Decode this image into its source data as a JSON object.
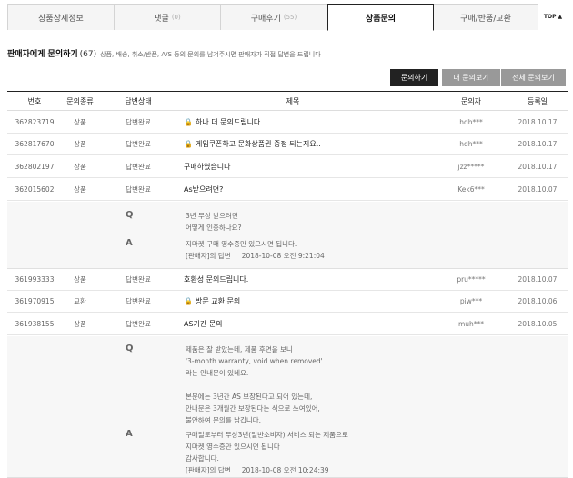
{
  "tabs": [
    {
      "label": "상품상세정보",
      "count": ""
    },
    {
      "label": "댓글",
      "count": "(0)"
    },
    {
      "label": "구매후기",
      "count": "(55)"
    },
    {
      "label": "상품문의",
      "count": ""
    },
    {
      "label": "구매/반품/교환",
      "count": ""
    },
    {
      "label": "TOP",
      "count": ""
    }
  ],
  "heading": {
    "title": "판매자에게 문의하기",
    "count": "(67)",
    "desc": "상품, 배송, 취소/반품, A/S 등의 문의를 남겨주시면 판매자가 직접 답변을 드립니다"
  },
  "buttons": {
    "ask": "문의하기",
    "my": "내 문의보기",
    "all": "전체 문의보기"
  },
  "columns": [
    "번호",
    "문의종류",
    "답변상태",
    "제목",
    "문의자",
    "등록일"
  ],
  "rows": [
    {
      "num": "362823719",
      "type": "상품",
      "status": "답변완료",
      "title": "하나 더 문의드립니다..",
      "locked": "🔒",
      "author": "hdh***",
      "date": "2018.10.17"
    },
    {
      "num": "362817670",
      "type": "상품",
      "status": "답변완료",
      "title": "게임쿠폰하고 문화상품권 증정 되는지요..",
      "locked": "🔒",
      "author": "hdh***",
      "date": "2018.10.17"
    },
    {
      "num": "362802197",
      "type": "상품",
      "status": "답변완료",
      "title": "구매하였습니다",
      "locked": "",
      "author": "jzz*****",
      "date": "2018.10.17"
    },
    {
      "num": "362015602",
      "type": "상품",
      "status": "답변완료",
      "title": "As받으려면?",
      "locked": "",
      "author": "Kek6***",
      "date": "2018.10.07"
    },
    {
      "num": "361993333",
      "type": "상품",
      "status": "답변완료",
      "title": "호환성 문의드립니다.",
      "locked": "",
      "author": "pru*****",
      "date": "2018.10.07"
    },
    {
      "num": "361970915",
      "type": "교환",
      "status": "답변완료",
      "title": "방문 교환 문의",
      "locked": "🔒",
      "author": "piw***",
      "date": "2018.10.06"
    },
    {
      "num": "361938155",
      "type": "상품",
      "status": "답변완료",
      "title": "AS기간 문의",
      "locked": "",
      "author": "muh***",
      "date": "2018.10.05"
    }
  ],
  "detail1": {
    "q_mark": "Q",
    "a_mark": "A",
    "question": "3년 무상 받으려면\n어떻게 인증하나요?",
    "answer": "지마켓 구매 영수증만 있으시면 됩니다.\n[판매자]의 답변  |  2018-10-08 오전 9:21:04"
  },
  "detail2": {
    "q_mark": "Q",
    "a_mark": "A",
    "question": "제품은 잘 받았는데, 제품 후면을 보니\n'3-month warranty, void when removed'\n라는 안내문이 있네요.\n\n본문에는 3년간 AS 보장된다고 되어 있는데,\n안내문은 3개월간 보장된다는 식으로 쓰여있어,\n불안하여 문의를 남깁니다.",
    "answer": "구매일로부터 무상3년(일반소비자) 서비스 되는 제품으로\n지마켓 영수증만 있으시면 됩니다\n감사합니다.\n[판매자]의 답변  |  2018-10-08 오전 10:24:39"
  }
}
